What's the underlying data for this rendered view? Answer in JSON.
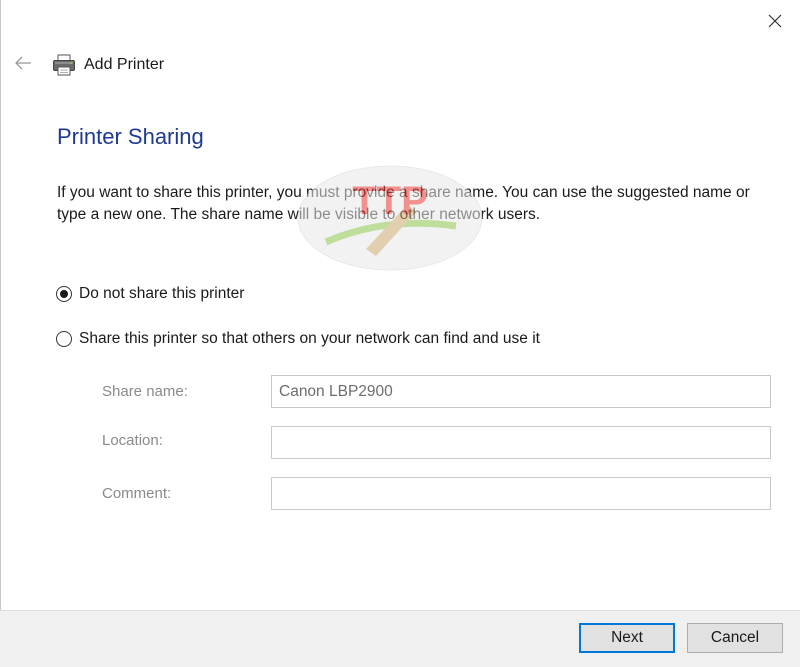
{
  "window": {
    "title": "Add Printer",
    "back_icon": "arrow-left-icon",
    "printer_icon": "printer-icon",
    "close_icon": "close-icon"
  },
  "page": {
    "title": "Printer Sharing",
    "description": "If you want to share this printer, you must provide a share name. You can use the suggested name or type a new one. The share name will be visible to other network users."
  },
  "options": {
    "no_share": {
      "label": "Do not share this printer",
      "selected": true
    },
    "share": {
      "label": "Share this printer so that others on your network can find and use it",
      "selected": false
    }
  },
  "fields": {
    "share_name": {
      "label": "Share name:",
      "value": "Canon LBP2900"
    },
    "location": {
      "label": "Location:",
      "value": ""
    },
    "comment": {
      "label": "Comment:",
      "value": ""
    }
  },
  "footer": {
    "next_label": "Next",
    "cancel_label": "Cancel"
  },
  "watermark": {
    "text": "TTP"
  },
  "colors": {
    "title_blue": "#1f3a93",
    "focus_blue": "#0078d7",
    "footer_bg": "#f0f0f0",
    "watermark_red": "#e53935"
  }
}
